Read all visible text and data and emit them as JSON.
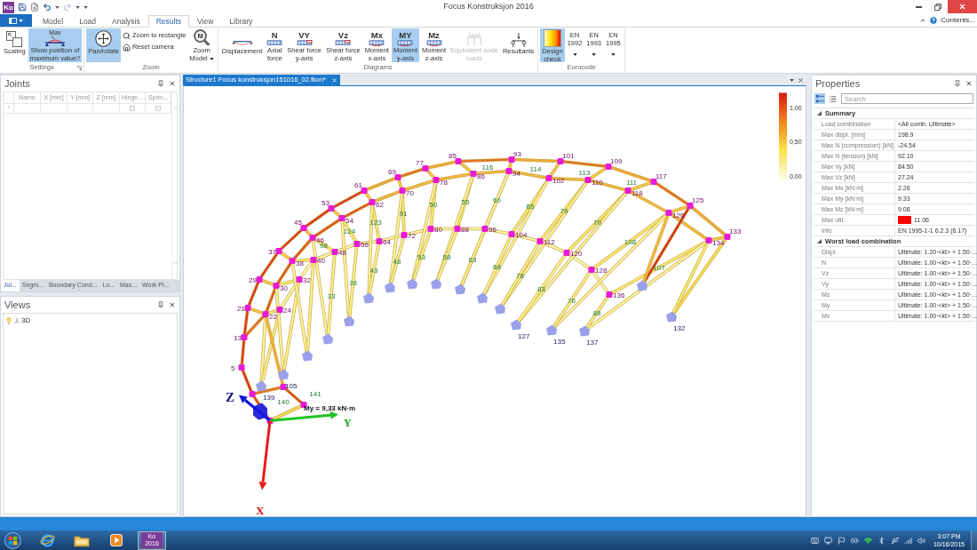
{
  "window": {
    "title": "Focus Konstruksjon 2016",
    "app_icon": "Ko"
  },
  "ribbon": {
    "tabs": [
      {
        "label": "Model",
        "selected": false
      },
      {
        "label": "Load",
        "selected": false
      },
      {
        "label": "Analysis",
        "selected": false
      },
      {
        "label": "Results",
        "selected": true
      },
      {
        "label": "View",
        "selected": false
      },
      {
        "label": "Library",
        "selected": false
      }
    ],
    "help_link": "Contents...",
    "groups": [
      {
        "label": "Settings",
        "launcher": true,
        "items": [
          {
            "kind": "large",
            "label": "Scaling",
            "selected": false,
            "disabled": false,
            "dropdown": false
          },
          {
            "kind": "large",
            "icon_text": "Max",
            "label": "Show position of\nmaximum value?",
            "selected": true,
            "disabled": false,
            "dropdown": false
          }
        ]
      },
      {
        "label": "Zoom",
        "launcher": false,
        "items": [
          {
            "kind": "large",
            "label": "Pan/rotate",
            "selected": true,
            "disabled": false,
            "dropdown": false
          },
          {
            "kind": "small",
            "label": "Zoom to rectangle",
            "selected": false,
            "disabled": false,
            "dropdown": false
          },
          {
            "kind": "small",
            "label": "Reset camera",
            "selected": false,
            "disabled": false,
            "dropdown": false
          },
          {
            "kind": "large",
            "icon_text": "M",
            "label": "Zoom\nModel",
            "selected": false,
            "disabled": false,
            "dropdown": true
          }
        ]
      },
      {
        "label": "Diagrams",
        "launcher": false,
        "items": [
          {
            "kind": "large",
            "label": "Displacement",
            "selected": false,
            "disabled": false,
            "dropdown": false
          },
          {
            "kind": "large",
            "icon_text": "N",
            "label": "Axial\nforce",
            "selected": false,
            "disabled": false,
            "dropdown": false
          },
          {
            "kind": "large",
            "icon_text": "VY",
            "label": "Shear force\ny-axis",
            "selected": false,
            "disabled": false,
            "dropdown": false
          },
          {
            "kind": "large",
            "icon_text": "Vz",
            "label": "Shear force\nz-axis",
            "selected": false,
            "disabled": false,
            "dropdown": false
          },
          {
            "kind": "large",
            "icon_text": "Mx",
            "label": "Moment\nx-axis",
            "selected": false,
            "disabled": false,
            "dropdown": false
          },
          {
            "kind": "large",
            "icon_text": "MY",
            "label": "Moment\ny-axis",
            "selected": true,
            "disabled": false,
            "dropdown": false
          },
          {
            "kind": "large",
            "icon_text": "Mz",
            "label": "Moment\nz-axis",
            "selected": false,
            "disabled": false,
            "dropdown": false
          },
          {
            "kind": "large",
            "label": "Equivalent node\nloads",
            "selected": false,
            "disabled": true,
            "dropdown": false
          },
          {
            "kind": "large",
            "label": "Resultants",
            "selected": false,
            "disabled": false,
            "dropdown": false
          }
        ]
      },
      {
        "label": "Eurocode",
        "launcher": false,
        "items": [
          {
            "kind": "large",
            "label": "Design\ncheck",
            "selected": true,
            "disabled": false,
            "dropdown": false
          },
          {
            "kind": "menu",
            "label": "EN\n1992",
            "selected": false,
            "disabled": false,
            "dropdown": true
          },
          {
            "kind": "menu",
            "label": "EN\n1993",
            "selected": false,
            "disabled": false,
            "dropdown": true
          },
          {
            "kind": "menu",
            "label": "EN\n1995",
            "selected": false,
            "disabled": false,
            "dropdown": true
          }
        ]
      }
    ]
  },
  "joints_panel": {
    "title": "Joints",
    "columns": [
      "Name",
      "X [mm]",
      "Y [mm]",
      "Z [mm]",
      "Hinge...",
      "Sprin..."
    ],
    "new_row": {
      "marker": "*",
      "hinge_checked": false,
      "spring_checked": false
    },
    "tabs": [
      {
        "label": "Joi...",
        "selected": true
      },
      {
        "label": "Segm...",
        "selected": false
      },
      {
        "label": "Boundary Cond...",
        "selected": false
      },
      {
        "label": "Lo...",
        "selected": false
      },
      {
        "label": "Mas...",
        "selected": false
      },
      {
        "label": "Work Pl...",
        "selected": false
      }
    ]
  },
  "views_panel": {
    "title": "Views",
    "items": [
      {
        "label": "3D",
        "visible": true
      }
    ]
  },
  "document_tabs": [
    {
      "label": "Structure1 Focus konstruksjon151016_02.fkon*",
      "selected": true
    }
  ],
  "model_view": {
    "legend": {
      "ticks": [
        "1,00",
        "0,50",
        "0,00"
      ]
    },
    "joint_labels": [
      "5",
      "13",
      "21",
      "29",
      "37",
      "45",
      "53",
      "61",
      "69",
      "77",
      "85",
      "93",
      "101",
      "109",
      "117",
      "125",
      "133",
      "22",
      "30",
      "38",
      "46",
      "54",
      "62",
      "70",
      "78",
      "86",
      "94",
      "102",
      "110",
      "118",
      "126",
      "134",
      "24",
      "32",
      "40",
      "48",
      "56",
      "64",
      "72",
      "80",
      "88",
      "96",
      "104",
      "112",
      "120",
      "128",
      "136"
    ],
    "member_labels": [
      "98",
      "124",
      "123",
      "91",
      "50",
      "55",
      "60",
      "65",
      "79",
      "70",
      "108",
      "107",
      "33",
      "38",
      "43",
      "48",
      "53",
      "58",
      "63",
      "68",
      "78",
      "83",
      "76",
      "88",
      "116",
      "114",
      "113",
      "111",
      "140",
      "141"
    ],
    "support_labels": [
      "139",
      "105",
      "127",
      "135",
      "137",
      "132"
    ],
    "axes": [
      {
        "kind": "z",
        "label": "Z"
      },
      {
        "kind": "y",
        "label": "Y"
      },
      {
        "kind": "x",
        "label": "X"
      }
    ],
    "result_label": "My = 9,33 kN·m"
  },
  "properties": {
    "title": "Properties",
    "view_modes": [
      {
        "kind": "categorized",
        "selected": true
      },
      {
        "kind": "alphabetical",
        "selected": false
      }
    ],
    "search_placeholder": "Search",
    "sections": [
      {
        "title": "Summary",
        "expanded": true,
        "rows": [
          {
            "name": "Load combination",
            "value": "<All comb. Ultimate>"
          },
          {
            "name": "Max displ. [mm]",
            "value": "198.9"
          },
          {
            "name": "Max N (compression) [kN]",
            "value": "-24.54"
          },
          {
            "name": "Max N (tension) [kN]",
            "value": "92.10"
          },
          {
            "name": "Max Vy [kN]",
            "value": "84.50"
          },
          {
            "name": "Max Vz [kN]",
            "value": "27.24"
          },
          {
            "name": "Max Mx [kN·m]",
            "value": "2.26"
          },
          {
            "name": "Max My [kN·m]",
            "value": "9.33"
          },
          {
            "name": "Max Mz [kN·m]",
            "value": "9.08"
          },
          {
            "name": "Max util.",
            "value": "11.06",
            "color": "#ff0000"
          },
          {
            "name": "Info",
            "value": "EN 1995-1-1 6.2.3 (6.17)"
          }
        ]
      },
      {
        "title": "Worst load combination",
        "expanded": true,
        "rows": [
          {
            "name": "Displ.",
            "value": "Ultimate: 1.20·<kt> + 1.50·..."
          },
          {
            "name": "N",
            "value": "Ultimate: 1.00·<kt> + 1.50·..."
          },
          {
            "name": "Vz",
            "value": "Ultimate: 1.00·<kt> + 1.50·..."
          },
          {
            "name": "Vy",
            "value": "Ultimate: 1.00·<kt> + 1.50·..."
          },
          {
            "name": "Mz",
            "value": "Ultimate: 1.00·<kt> + 1.50·..."
          },
          {
            "name": "My",
            "value": "Ultimate: 1.00·<kt> + 1.50·..."
          },
          {
            "name": "Mx",
            "value": "Ultimate: 1.00·<kt> + 1.50·..."
          }
        ]
      }
    ]
  },
  "taskbar": {
    "apps": [
      {
        "label": "Ko\n2016",
        "selected": true
      }
    ],
    "time": "3:07 PM",
    "date": "10/16/2015"
  }
}
